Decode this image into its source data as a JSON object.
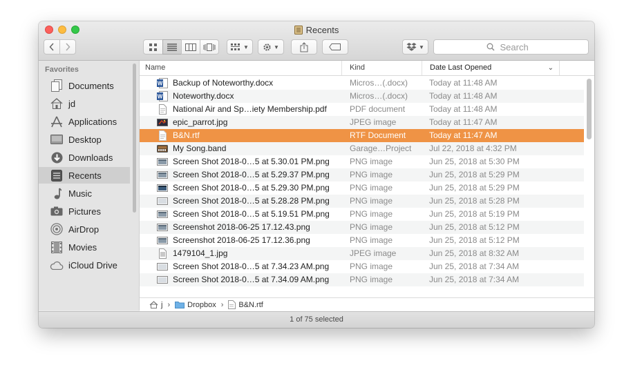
{
  "window": {
    "title": "Recents",
    "status": "1 of 75 selected"
  },
  "toolbar": {
    "search_placeholder": "Search",
    "icons": [
      "chevron-left-icon",
      "chevron-right-icon",
      "icon-view-icon",
      "list-view-icon",
      "column-view-icon",
      "cover-flow-icon",
      "group-icon",
      "gear-icon",
      "share-icon",
      "tag-icon",
      "dropbox-icon",
      "search-icon"
    ]
  },
  "sidebar": {
    "heading": "Favorites",
    "items": [
      {
        "label": "Documents",
        "icon": "documents-icon"
      },
      {
        "label": "jd",
        "icon": "home-icon"
      },
      {
        "label": "Applications",
        "icon": "applications-icon"
      },
      {
        "label": "Desktop",
        "icon": "desktop-icon"
      },
      {
        "label": "Downloads",
        "icon": "downloads-icon"
      },
      {
        "label": "Recents",
        "icon": "recents-icon",
        "selected": true
      },
      {
        "label": "Music",
        "icon": "music-icon"
      },
      {
        "label": "Pictures",
        "icon": "pictures-icon"
      },
      {
        "label": "AirDrop",
        "icon": "airdrop-icon"
      },
      {
        "label": "Movies",
        "icon": "movies-icon"
      },
      {
        "label": "iCloud Drive",
        "icon": "cloud-icon"
      }
    ]
  },
  "columns": {
    "name": "Name",
    "kind": "Kind",
    "date": "Date Last Opened"
  },
  "files": [
    {
      "name": "Backup of Noteworthy.docx",
      "kind": "Micros…(.docx)",
      "date": "Today at 11:48 AM",
      "icon": "word-icon"
    },
    {
      "name": "Noteworthy.docx",
      "kind": "Micros…(.docx)",
      "date": "Today at 11:48 AM",
      "icon": "word-icon"
    },
    {
      "name": "National Air and Sp…iety Membership.pdf",
      "kind": "PDF document",
      "date": "Today at 11:48 AM",
      "icon": "pdf-icon"
    },
    {
      "name": "epic_parrot.jpg",
      "kind": "JPEG image",
      "date": "Today at 11:47 AM",
      "icon": "photo-icon"
    },
    {
      "name": "B&N.rtf",
      "kind": "RTF Document",
      "date": "Today at 11:47 AM",
      "icon": "rtf-icon",
      "selected": true
    },
    {
      "name": "My Song.band",
      "kind": "Garage…Project",
      "date": "Jul 22, 2018 at 4:32 PM",
      "icon": "garageband-icon"
    },
    {
      "name": "Screen Shot 2018-0…5 at 5.30.01 PM.png",
      "kind": "PNG image",
      "date": "Jun 25, 2018 at 5:30 PM",
      "icon": "screenshot-icon"
    },
    {
      "name": "Screen Shot 2018-0…5 at 5.29.37 PM.png",
      "kind": "PNG image",
      "date": "Jun 25, 2018 at 5:29 PM",
      "icon": "screenshot-icon"
    },
    {
      "name": "Screen Shot 2018-0…5 at 5.29.30 PM.png",
      "kind": "PNG image",
      "date": "Jun 25, 2018 at 5:29 PM",
      "icon": "screenshot-icon"
    },
    {
      "name": "Screen Shot 2018-0…5 at 5.28.28 PM.png",
      "kind": "PNG image",
      "date": "Jun 25, 2018 at 5:28 PM",
      "icon": "screenshot-icon"
    },
    {
      "name": "Screen Shot 2018-0…5 at 5.19.51 PM.png",
      "kind": "PNG image",
      "date": "Jun 25, 2018 at 5:19 PM",
      "icon": "screenshot-icon"
    },
    {
      "name": "Screenshot 2018-06-25 17.12.43.png",
      "kind": "PNG image",
      "date": "Jun 25, 2018 at 5:12 PM",
      "icon": "screenshot-icon"
    },
    {
      "name": "Screenshot 2018-06-25 17.12.36.png",
      "kind": "PNG image",
      "date": "Jun 25, 2018 at 5:12 PM",
      "icon": "screenshot-icon"
    },
    {
      "name": "1479104_1.jpg",
      "kind": "JPEG image",
      "date": "Jun 25, 2018 at 8:32 AM",
      "icon": "photo-icon"
    },
    {
      "name": "Screen Shot 2018-0…5 at 7.34.23 AM.png",
      "kind": "PNG image",
      "date": "Jun 25, 2018 at 7:34 AM",
      "icon": "screenshot-icon"
    },
    {
      "name": "Screen Shot 2018-0…5 at 7.34.09 AM.png",
      "kind": "PNG image",
      "date": "Jun 25, 2018 at 7:34 AM",
      "icon": "screenshot-icon"
    }
  ],
  "pathbar": [
    {
      "label": "j",
      "icon": "home-icon"
    },
    {
      "label": "Dropbox",
      "icon": "folder-icon"
    },
    {
      "label": "B&N.rtf",
      "icon": "rtf-icon"
    }
  ],
  "colors": {
    "selection": "#ef9345",
    "sidebar_selection": "#cfcfcf",
    "alt_row": "#f4f5f5"
  }
}
